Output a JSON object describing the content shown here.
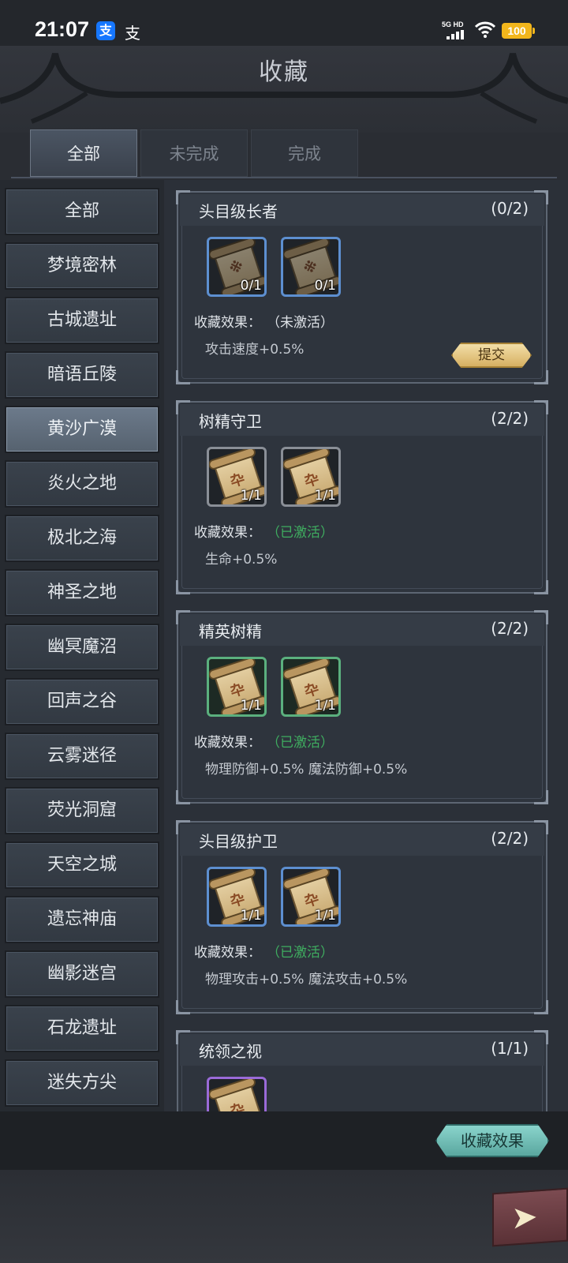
{
  "status_bar": {
    "time": "21:07",
    "network": "5G HD",
    "battery": "100",
    "alipay_icon": "支",
    "alipay_icon2": "支"
  },
  "header": {
    "title": "收藏"
  },
  "tabs": [
    {
      "label": "全部",
      "active": true
    },
    {
      "label": "未完成",
      "active": false
    },
    {
      "label": "完成",
      "active": false
    }
  ],
  "sidebar": {
    "items": [
      {
        "label": "全部"
      },
      {
        "label": "梦境密林"
      },
      {
        "label": "古城遗址"
      },
      {
        "label": "暗语丘陵"
      },
      {
        "label": "黄沙广漠",
        "active": true
      },
      {
        "label": "炎火之地"
      },
      {
        "label": "极北之海"
      },
      {
        "label": "神圣之地"
      },
      {
        "label": "幽冥魔沼"
      },
      {
        "label": "回声之谷"
      },
      {
        "label": "云雾迷径"
      },
      {
        "label": "荧光洞窟"
      },
      {
        "label": "天空之城"
      },
      {
        "label": "遗忘神庙"
      },
      {
        "label": "幽影迷宫"
      },
      {
        "label": "石龙遗址"
      },
      {
        "label": "迷失方尖"
      }
    ]
  },
  "collections": [
    {
      "title": "头目级长者",
      "progress": "(0/2)",
      "items": [
        {
          "count": "0/1",
          "frame": "blue"
        },
        {
          "count": "0/1",
          "frame": "blue"
        }
      ],
      "effect_label": "收藏效果：",
      "effect_status": "（未激活）",
      "effects": "攻击速度+0.5%",
      "submit_label": "提交"
    },
    {
      "title": "树精守卫",
      "progress": "(2/2)",
      "items": [
        {
          "count": "1/1",
          "frame": "gray"
        },
        {
          "count": "1/1",
          "frame": "gray"
        }
      ],
      "effect_label": "收藏效果：",
      "effect_status": "（已激活）",
      "effects": "生命+0.5%"
    },
    {
      "title": "精英树精",
      "progress": "(2/2)",
      "items": [
        {
          "count": "1/1",
          "frame": "green"
        },
        {
          "count": "1/1",
          "frame": "green"
        }
      ],
      "effect_label": "收藏效果：",
      "effect_status": "（已激活）",
      "effects": "物理防御+0.5%  魔法防御+0.5%"
    },
    {
      "title": "头目级护卫",
      "progress": "(2/2)",
      "items": [
        {
          "count": "1/1",
          "frame": "blue"
        },
        {
          "count": "1/1",
          "frame": "blue"
        }
      ],
      "effect_label": "收藏效果：",
      "effect_status": "（已激活）",
      "effects": "物理攻击+0.5%  魔法攻击+0.5%"
    },
    {
      "title": "统领之视",
      "progress": "(1/1)",
      "items": [
        {
          "frame": "purple"
        }
      ]
    }
  ],
  "footer": {
    "collection_effect_button": "收藏效果"
  },
  "icons": {
    "scroll": "scroll-icon",
    "back": "arrow-right-icon"
  },
  "colors": {
    "active_status": "#3fae60",
    "submit_gold": "#d6b062",
    "effect_teal": "#5aa79f"
  }
}
